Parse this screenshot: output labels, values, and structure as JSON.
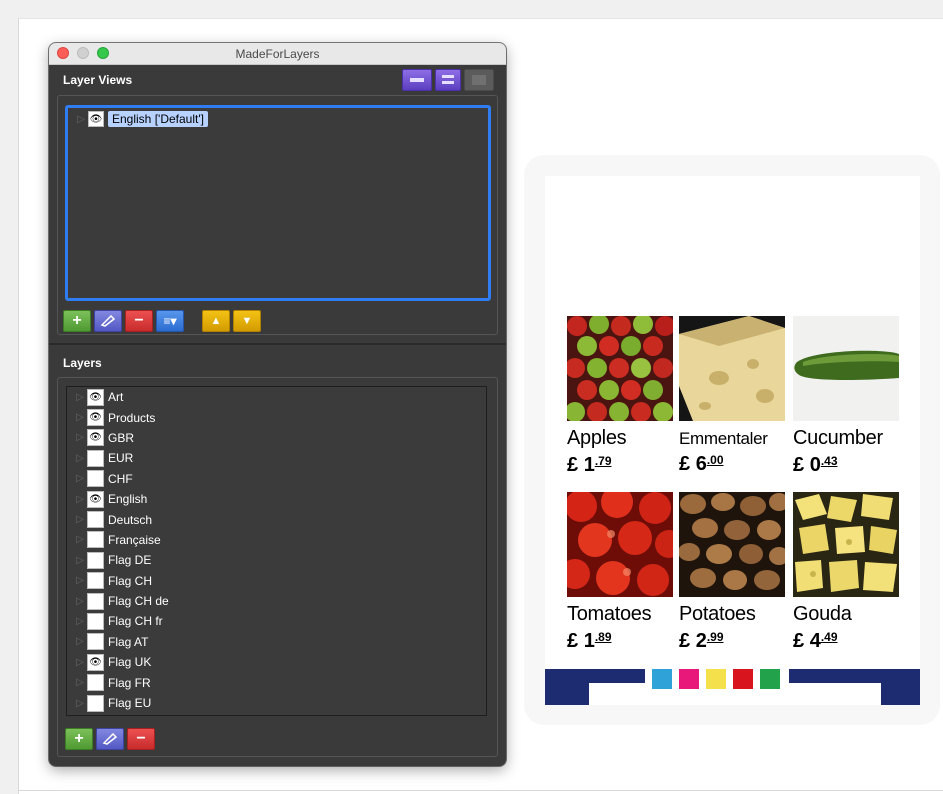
{
  "window": {
    "title": "MadeForLayers"
  },
  "layer_views": {
    "heading": "Layer Views",
    "items": [
      {
        "label": "English ['Default']",
        "visible": true,
        "selected": true
      }
    ],
    "toolbar_icons": [
      "add-icon",
      "edit-pencil-icon",
      "remove-icon",
      "list-menu-icon",
      "move-up-icon",
      "move-down-icon"
    ]
  },
  "layers": {
    "heading": "Layers",
    "items": [
      {
        "label": "Art",
        "visible": true
      },
      {
        "label": "Products",
        "visible": true
      },
      {
        "label": "GBR",
        "visible": true
      },
      {
        "label": "EUR",
        "visible": false
      },
      {
        "label": "CHF",
        "visible": false
      },
      {
        "label": "English",
        "visible": true
      },
      {
        "label": "Deutsch",
        "visible": false
      },
      {
        "label": "Française",
        "visible": false
      },
      {
        "label": "Flag DE",
        "visible": false
      },
      {
        "label": "Flag CH",
        "visible": false
      },
      {
        "label": "Flag CH de",
        "visible": false
      },
      {
        "label": "Flag CH fr",
        "visible": false
      },
      {
        "label": "Flag AT",
        "visible": false
      },
      {
        "label": "Flag UK",
        "visible": true
      },
      {
        "label": "Flag FR",
        "visible": false
      },
      {
        "label": "Flag EU",
        "visible": false
      }
    ]
  },
  "products": [
    {
      "name": "Apples",
      "currency": "£",
      "pounds": "1",
      "pence": ".79"
    },
    {
      "name": "Emmentaler",
      "currency": "£",
      "pounds": "6",
      "pence": ".00"
    },
    {
      "name": "Cucumber",
      "currency": "£",
      "pounds": "0",
      "pence": ".43"
    },
    {
      "name": "Tomatoes",
      "currency": "£",
      "pounds": "1",
      "pence": ".89"
    },
    {
      "name": "Potatoes",
      "currency": "£",
      "pounds": "2",
      "pence": ".99"
    },
    {
      "name": "Gouda",
      "currency": "£",
      "pounds": "4",
      "pence": ".49"
    }
  ],
  "colors": {
    "accent_blue": "#2f7df0",
    "band_navy": "#1d2c70",
    "swatches": [
      "#2fa3d8",
      "#e8177a",
      "#f3e04a",
      "#d8141f",
      "#22a24a"
    ]
  }
}
